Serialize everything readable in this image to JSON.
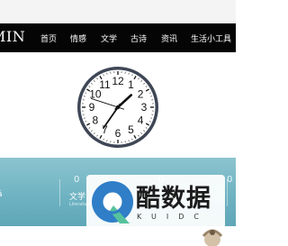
{
  "header": {
    "brand": "MIN",
    "nav": [
      {
        "label": "首页"
      },
      {
        "label": "情感"
      },
      {
        "label": "文学"
      },
      {
        "label": "古诗"
      },
      {
        "label": "资讯"
      },
      {
        "label": "生活小工具"
      }
    ]
  },
  "clock": {
    "numerals": [
      "12",
      "1",
      "2",
      "3",
      "4",
      "5",
      "6",
      "7",
      "8",
      "9",
      "10",
      "11"
    ],
    "hour": 1,
    "minute": 35,
    "second": 48
  },
  "hero": {
    "left_edge_label": "ǎ",
    "stats": [
      {
        "value": "0",
        "label": "文学",
        "sub": "Literature"
      },
      {
        "value": "0",
        "label": ""
      },
      {
        "value": "0",
        "label": ""
      }
    ]
  },
  "watermark": {
    "text": "酷数据",
    "sub": "KUIDC",
    "icon": "kuidc-logo-icon"
  },
  "colors": {
    "nav_bg": "#050505",
    "hero": "#6fb3c2",
    "watermark_blue": "#2f7ec7"
  }
}
